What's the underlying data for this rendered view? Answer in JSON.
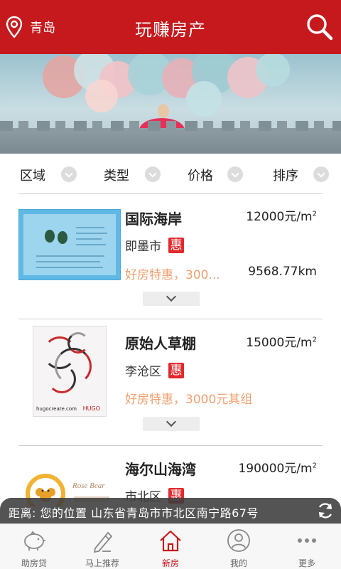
{
  "header": {
    "city": "青岛",
    "title": "玩赚房产"
  },
  "banner": {
    "alt": "banner-advertisement"
  },
  "filters": [
    {
      "label": "区域"
    },
    {
      "label": "类型"
    },
    {
      "label": "价格"
    },
    {
      "label": "排序"
    }
  ],
  "listings": [
    {
      "name": "国际海岸",
      "price": "12000元/m",
      "price_sup": "2",
      "district": "即墨市",
      "badge": "惠",
      "promo": "好房特惠，300...",
      "distance": "9568.77km"
    },
    {
      "name": "原始人草棚",
      "price": "15000元/m",
      "price_sup": "2",
      "district": "李沧区",
      "badge": "惠",
      "promo": "好房特惠，3000元其组",
      "distance": "",
      "poster_caption": "hugocreate.com",
      "poster_brand": "HUGO"
    },
    {
      "name": "海尔山海湾",
      "price": "190000元/m",
      "price_sup": "2",
      "district": "市北区",
      "badge": "惠",
      "promo": "",
      "distance": ""
    }
  ],
  "location_toast": {
    "text": "距离: 您的位置   山东省青岛市市北区南宁路67号"
  },
  "nav": [
    {
      "label": "助房贷",
      "icon": "piggy-bank-icon",
      "active": false
    },
    {
      "label": "马上推荐",
      "icon": "pen-icon",
      "active": false
    },
    {
      "label": "新房",
      "icon": "house-icon",
      "active": true
    },
    {
      "label": "我的",
      "icon": "user-icon",
      "active": false
    },
    {
      "label": "更多",
      "icon": "more-dots-icon",
      "active": false
    }
  ],
  "colors": {
    "brand_red": "#c6191d",
    "badge_red": "#e12a2f",
    "promo_orange": "#f0a070"
  }
}
